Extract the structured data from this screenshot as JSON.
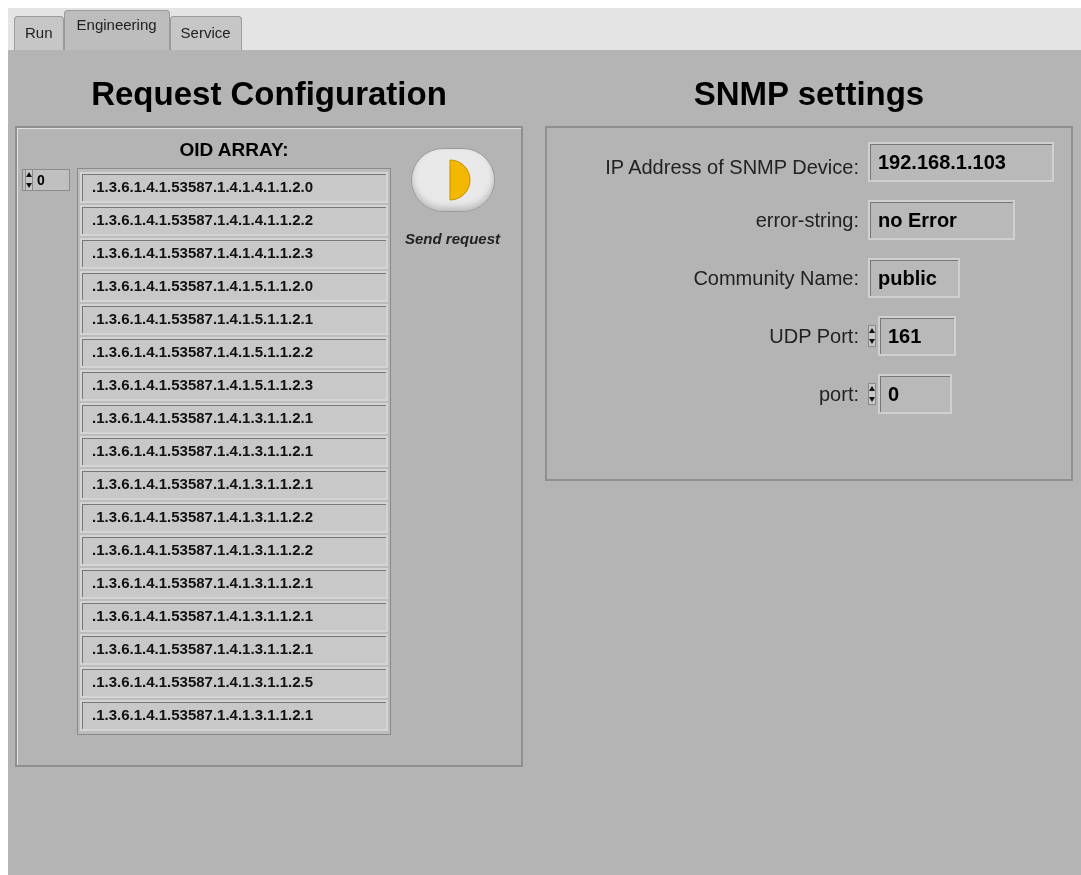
{
  "tabs": [
    {
      "label": "Run",
      "selected": false
    },
    {
      "label": "Engineering",
      "selected": true
    },
    {
      "label": "Service",
      "selected": false
    }
  ],
  "request_configuration": {
    "title": "Request Configuration",
    "oid_array": {
      "label": "OID ARRAY:",
      "index": "0",
      "items": [
        ".1.3.6.1.4.1.53587.1.4.1.4.1.1.2.0",
        ".1.3.6.1.4.1.53587.1.4.1.4.1.1.2.2",
        ".1.3.6.1.4.1.53587.1.4.1.4.1.1.2.3",
        ".1.3.6.1.4.1.53587.1.4.1.5.1.1.2.0",
        ".1.3.6.1.4.1.53587.1.4.1.5.1.1.2.1",
        ".1.3.6.1.4.1.53587.1.4.1.5.1.1.2.2",
        ".1.3.6.1.4.1.53587.1.4.1.5.1.1.2.3",
        ".1.3.6.1.4.1.53587.1.4.1.3.1.1.2.1",
        ".1.3.6.1.4.1.53587.1.4.1.3.1.1.2.1",
        ".1.3.6.1.4.1.53587.1.4.1.3.1.1.2.1",
        ".1.3.6.1.4.1.53587.1.4.1.3.1.1.2.2",
        ".1.3.6.1.4.1.53587.1.4.1.3.1.1.2.2",
        ".1.3.6.1.4.1.53587.1.4.1.3.1.1.2.1",
        ".1.3.6.1.4.1.53587.1.4.1.3.1.1.2.1",
        ".1.3.6.1.4.1.53587.1.4.1.3.1.1.2.1",
        ".1.3.6.1.4.1.53587.1.4.1.3.1.1.2.5",
        ".1.3.6.1.4.1.53587.1.4.1.3.1.1.2.1"
      ]
    },
    "send_button": {
      "label": "Send request",
      "on": true
    }
  },
  "snmp_settings": {
    "title": "SNMP settings",
    "fields": [
      {
        "label": "IP Address of SNMP Device:",
        "value": "192.168.1.103",
        "kind": "text"
      },
      {
        "label": "error-string:",
        "value": "no Error",
        "kind": "text"
      },
      {
        "label": "Community Name:",
        "value": "public",
        "kind": "text"
      },
      {
        "label": "UDP Port:",
        "value": "161",
        "kind": "numeric"
      },
      {
        "label": "port:",
        "value": "0",
        "kind": "numeric"
      }
    ]
  }
}
